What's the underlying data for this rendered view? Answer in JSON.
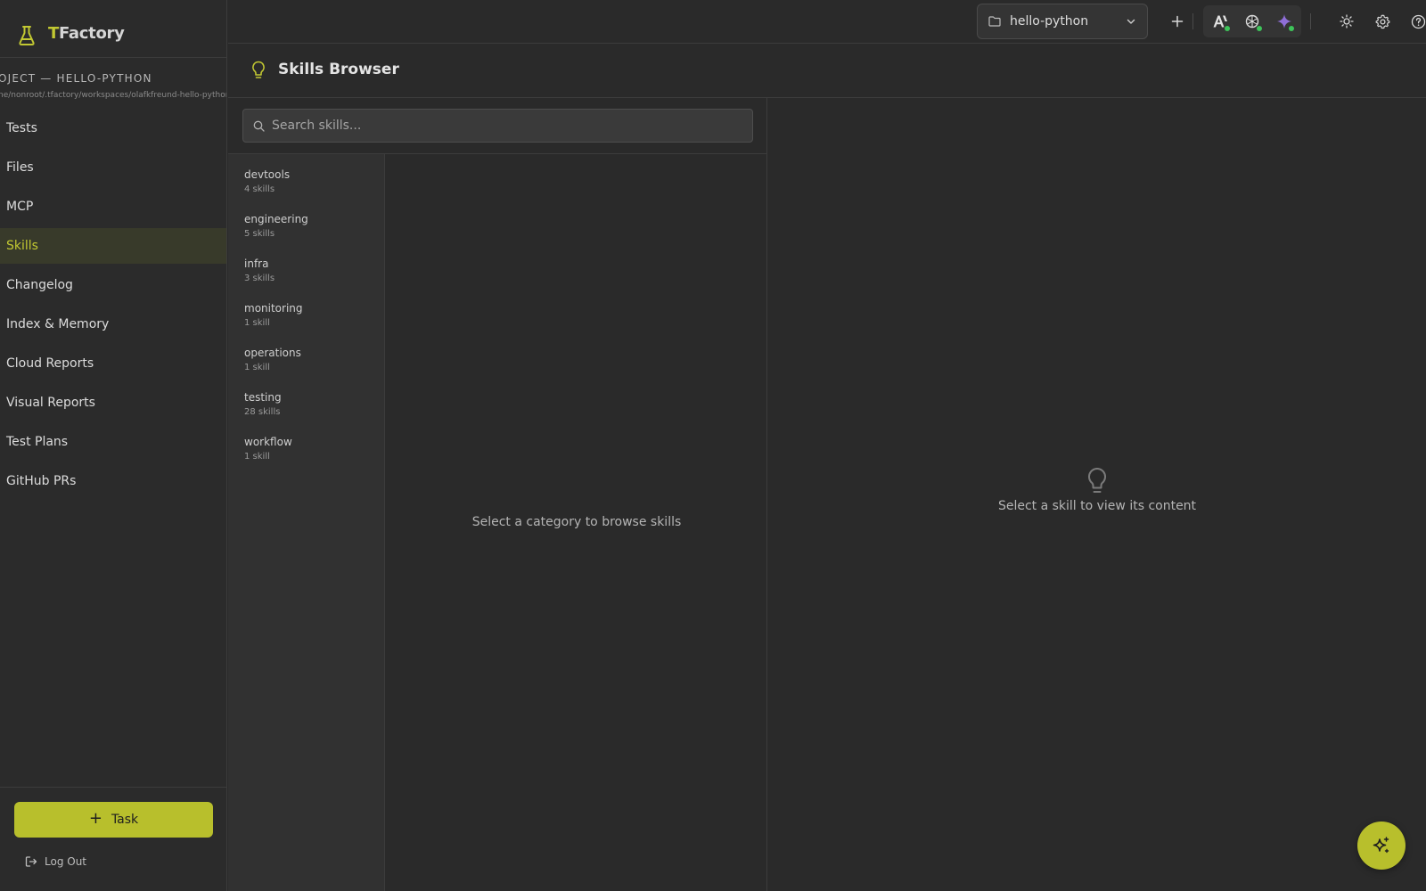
{
  "app": {
    "brand_first_letter": "T",
    "brand_rest": "Factory",
    "accent_color": "#b8bf2c"
  },
  "sidebar": {
    "project_heading": "OJECT — HELLO-PYTHON",
    "project_path": "ne/nonroot/.tfactory/workspaces/olafkfreund-hello-python",
    "items": [
      {
        "label": "Tests",
        "active": false
      },
      {
        "label": "Files",
        "active": false
      },
      {
        "label": "MCP",
        "active": false
      },
      {
        "label": "Skills",
        "active": true
      },
      {
        "label": "Changelog",
        "active": false
      },
      {
        "label": "Index & Memory",
        "active": false
      },
      {
        "label": "Cloud Reports",
        "active": false
      },
      {
        "label": "Visual Reports",
        "active": false
      },
      {
        "label": "Test Plans",
        "active": false
      },
      {
        "label": "GitHub PRs",
        "active": false
      }
    ],
    "task_button_label": "Task",
    "logout_label": "Log Out"
  },
  "topbar": {
    "project_selector_value": "hello-python",
    "icons": [
      "add-icon",
      "anthropic-icon",
      "openai-icon",
      "gemini-icon",
      "theme-sun-icon",
      "settings-gear-icon",
      "help-icon"
    ]
  },
  "page": {
    "title": "Skills Browser",
    "search_placeholder": "Search skills...",
    "search_value": "",
    "categories": [
      {
        "name": "devtools",
        "count": "4 skills"
      },
      {
        "name": "engineering",
        "count": "5 skills"
      },
      {
        "name": "infra",
        "count": "3 skills"
      },
      {
        "name": "monitoring",
        "count": "1 skill"
      },
      {
        "name": "operations",
        "count": "1 skill"
      },
      {
        "name": "testing",
        "count": "28 skills"
      },
      {
        "name": "workflow",
        "count": "1 skill"
      }
    ],
    "empty_category_message": "Select a category to browse skills",
    "empty_skill_message": "Select a skill to view its content"
  }
}
